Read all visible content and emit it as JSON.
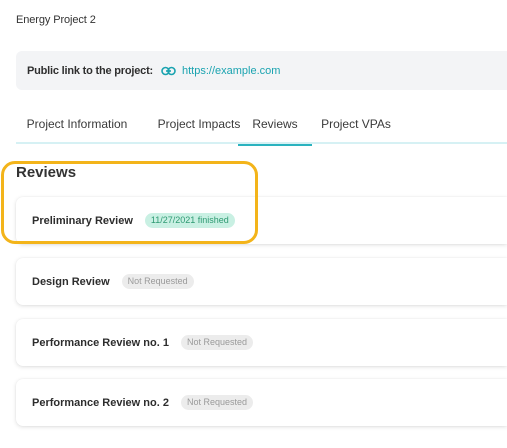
{
  "project": {
    "title": "Energy Project 2"
  },
  "public_link": {
    "label": "Public link to the project:",
    "url": "https://example.com"
  },
  "tabs": [
    {
      "label": "Project Information",
      "active": false
    },
    {
      "label": "Project Impacts",
      "active": false
    },
    {
      "label": "Reviews",
      "active": true
    },
    {
      "label": "Project VPAs",
      "active": false
    }
  ],
  "section": {
    "title": "Reviews"
  },
  "reviews": [
    {
      "title": "Preliminary Review",
      "status": "11/27/2021 finished",
      "status_type": "finished"
    },
    {
      "title": "Design Review",
      "status": "Not Requested",
      "status_type": "not-requested"
    },
    {
      "title": "Performance Review no. 1",
      "status": "Not Requested",
      "status_type": "not-requested"
    },
    {
      "title": "Performance Review no. 2",
      "status": "Not Requested",
      "status_type": "not-requested"
    }
  ],
  "colors": {
    "accent": "#2bb3bf",
    "highlight": "#f3b41a",
    "finished_badge": "#c9f0e3",
    "not_requested_badge": "#ececec"
  },
  "icons": {
    "link": "link-icon"
  }
}
